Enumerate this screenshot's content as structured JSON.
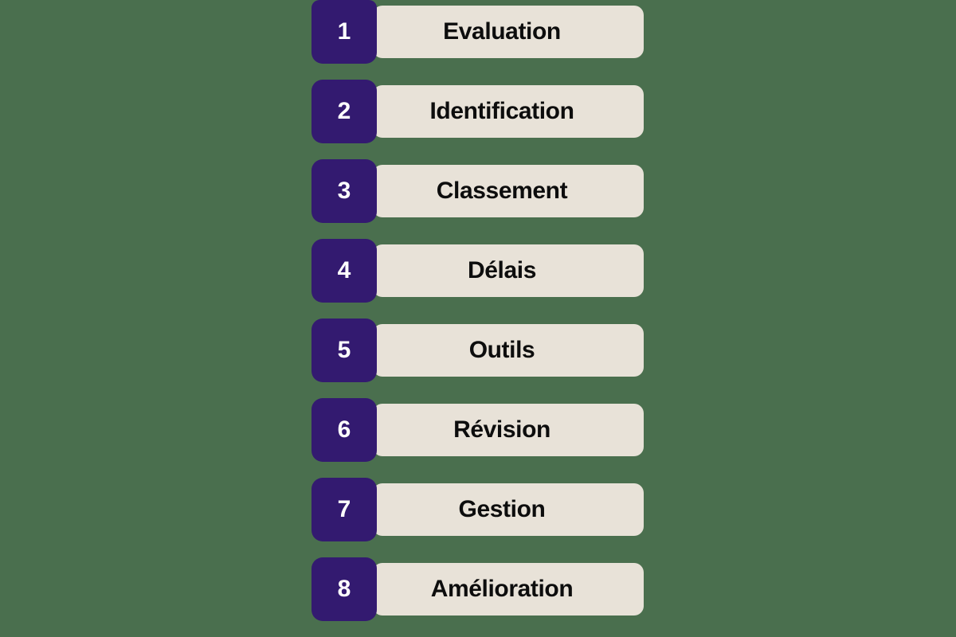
{
  "theme": {
    "background_color": "#4a6f4e",
    "badge_color": "#331a70",
    "bar_color": "#e8e2d8",
    "label_text_color": "#0d0d0d",
    "number_text_color": "#ffffff"
  },
  "list": {
    "items": [
      {
        "number": "1",
        "label": "Evaluation"
      },
      {
        "number": "2",
        "label": "Identification"
      },
      {
        "number": "3",
        "label": "Classement"
      },
      {
        "number": "4",
        "label": "Délais"
      },
      {
        "number": "5",
        "label": "Outils"
      },
      {
        "number": "6",
        "label": "Révision"
      },
      {
        "number": "7",
        "label": "Gestion"
      },
      {
        "number": "8",
        "label": "Amélioration"
      }
    ]
  }
}
